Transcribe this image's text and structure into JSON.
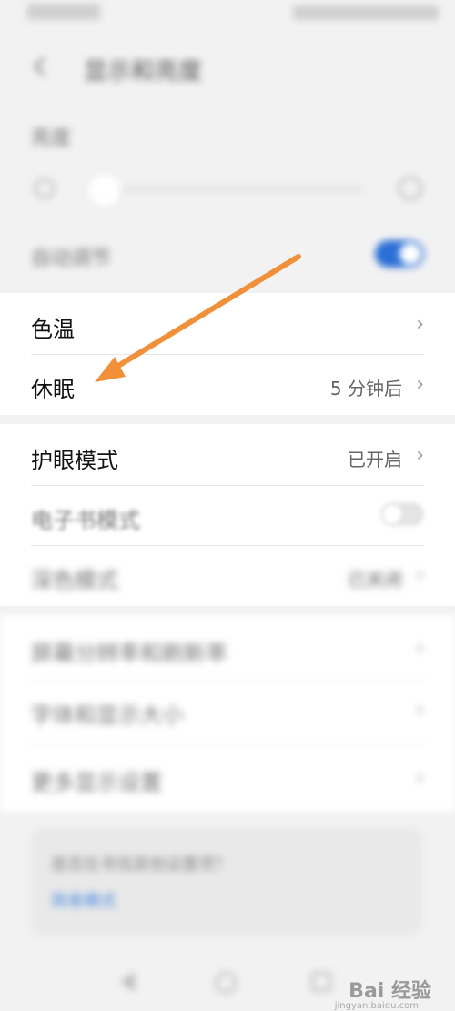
{
  "header": {
    "title": "显示和亮度"
  },
  "brightness": {
    "label": "亮度"
  },
  "auto_adjust": {
    "label": "自动调节",
    "enabled": true
  },
  "rows_primary": [
    {
      "label": "色温",
      "value": ""
    },
    {
      "label": "休眠",
      "value": "5 分钟后"
    }
  ],
  "rows_secondary": [
    {
      "label": "护眼模式",
      "value": "已开启"
    },
    {
      "label": "电子书模式",
      "toggle": false
    },
    {
      "label": "深色模式",
      "value": "已关闭"
    }
  ],
  "rows_tertiary": [
    {
      "label": "屏幕分辨率和刷新率"
    },
    {
      "label": "字体和显示大小"
    },
    {
      "label": "更多显示设置"
    }
  ],
  "tip": {
    "text": "是否在寻找其他设置项？",
    "link": "简易模式"
  },
  "watermark": {
    "text": "Bai 经验",
    "sub": "jingyan.baidu.com"
  },
  "colors": {
    "accent": "#2a6fd6",
    "arrow": "#f0913a"
  }
}
